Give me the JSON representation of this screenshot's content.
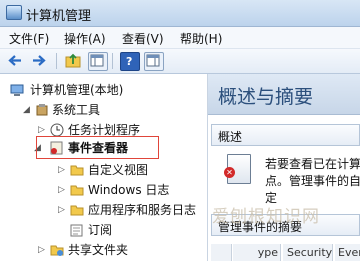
{
  "window": {
    "title": "计算机管理"
  },
  "menu": [
    {
      "label": "文件(F)"
    },
    {
      "label": "操作(A)"
    },
    {
      "label": "查看(V)"
    },
    {
      "label": "帮助(H)"
    }
  ],
  "toolbar": {
    "buttons": [
      "back-arrow-icon",
      "forward-arrow-icon",
      "up-folder-icon",
      "show-hide-tree-icon",
      "help-icon",
      "properties-icon"
    ]
  },
  "tree": {
    "items": [
      {
        "label": "计算机管理(本地)",
        "icon": "computer-management-icon"
      },
      {
        "label": "系统工具",
        "icon": "system-tools-icon"
      },
      {
        "label": "任务计划程序",
        "icon": "clock-icon"
      },
      {
        "label": "事件查看器",
        "icon": "event-viewer-icon",
        "selected": true
      },
      {
        "label": "自定义视图",
        "icon": "folder-icon"
      },
      {
        "label": "Windows 日志",
        "icon": "folder-icon"
      },
      {
        "label": "应用程序和服务日志",
        "icon": "folder-icon"
      },
      {
        "label": "订阅",
        "icon": "subscription-icon"
      },
      {
        "label": "共享文件夹",
        "icon": "shared-folder-icon"
      }
    ]
  },
  "main": {
    "header": "概述与摘要",
    "overview_title": "概述",
    "overview_text_line1": "若要查看已在计算",
    "overview_text_line2": "点。管理事件的自定",
    "events_summary_title": "管理事件的摘要",
    "bottom_cells": [
      "",
      "ype",
      "Security",
      "Event"
    ]
  },
  "watermark": "爱刨根知识网"
}
